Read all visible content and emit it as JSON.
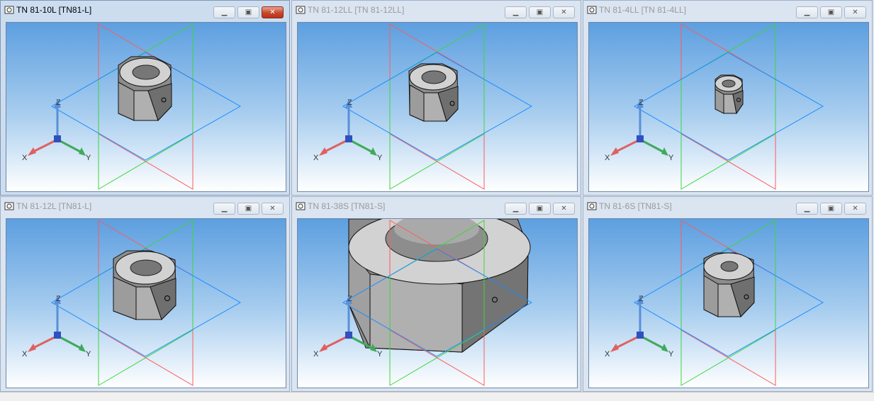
{
  "windows": [
    {
      "title": "TN 81-10L [TN81-L]",
      "active": true
    },
    {
      "title": "TN 81-12LL [TN 81-12LL]",
      "active": false
    },
    {
      "title": "TN 81-4LL [TN 81-4LL]",
      "active": false
    },
    {
      "title": "TN 81-12L [TN81-L]",
      "active": false
    },
    {
      "title": "TN 81-38S [TN81-S]",
      "active": false
    },
    {
      "title": "TN 81-6S [TN81-S]",
      "active": false
    }
  ],
  "controls": {
    "minimize": "▁",
    "maximize": "▣",
    "close": "✕"
  },
  "axes": {
    "x": "X",
    "y": "Y",
    "z": "Z"
  },
  "colors": {
    "x_axis": "#e06060",
    "y_axis": "#3faa5a",
    "z_axis": "#5a8fd8",
    "plane_red": "#ff4a4a",
    "plane_green": "#3cd63c",
    "plane_blue": "#1a8cff"
  },
  "icons": {
    "window": "model-document-icon"
  }
}
